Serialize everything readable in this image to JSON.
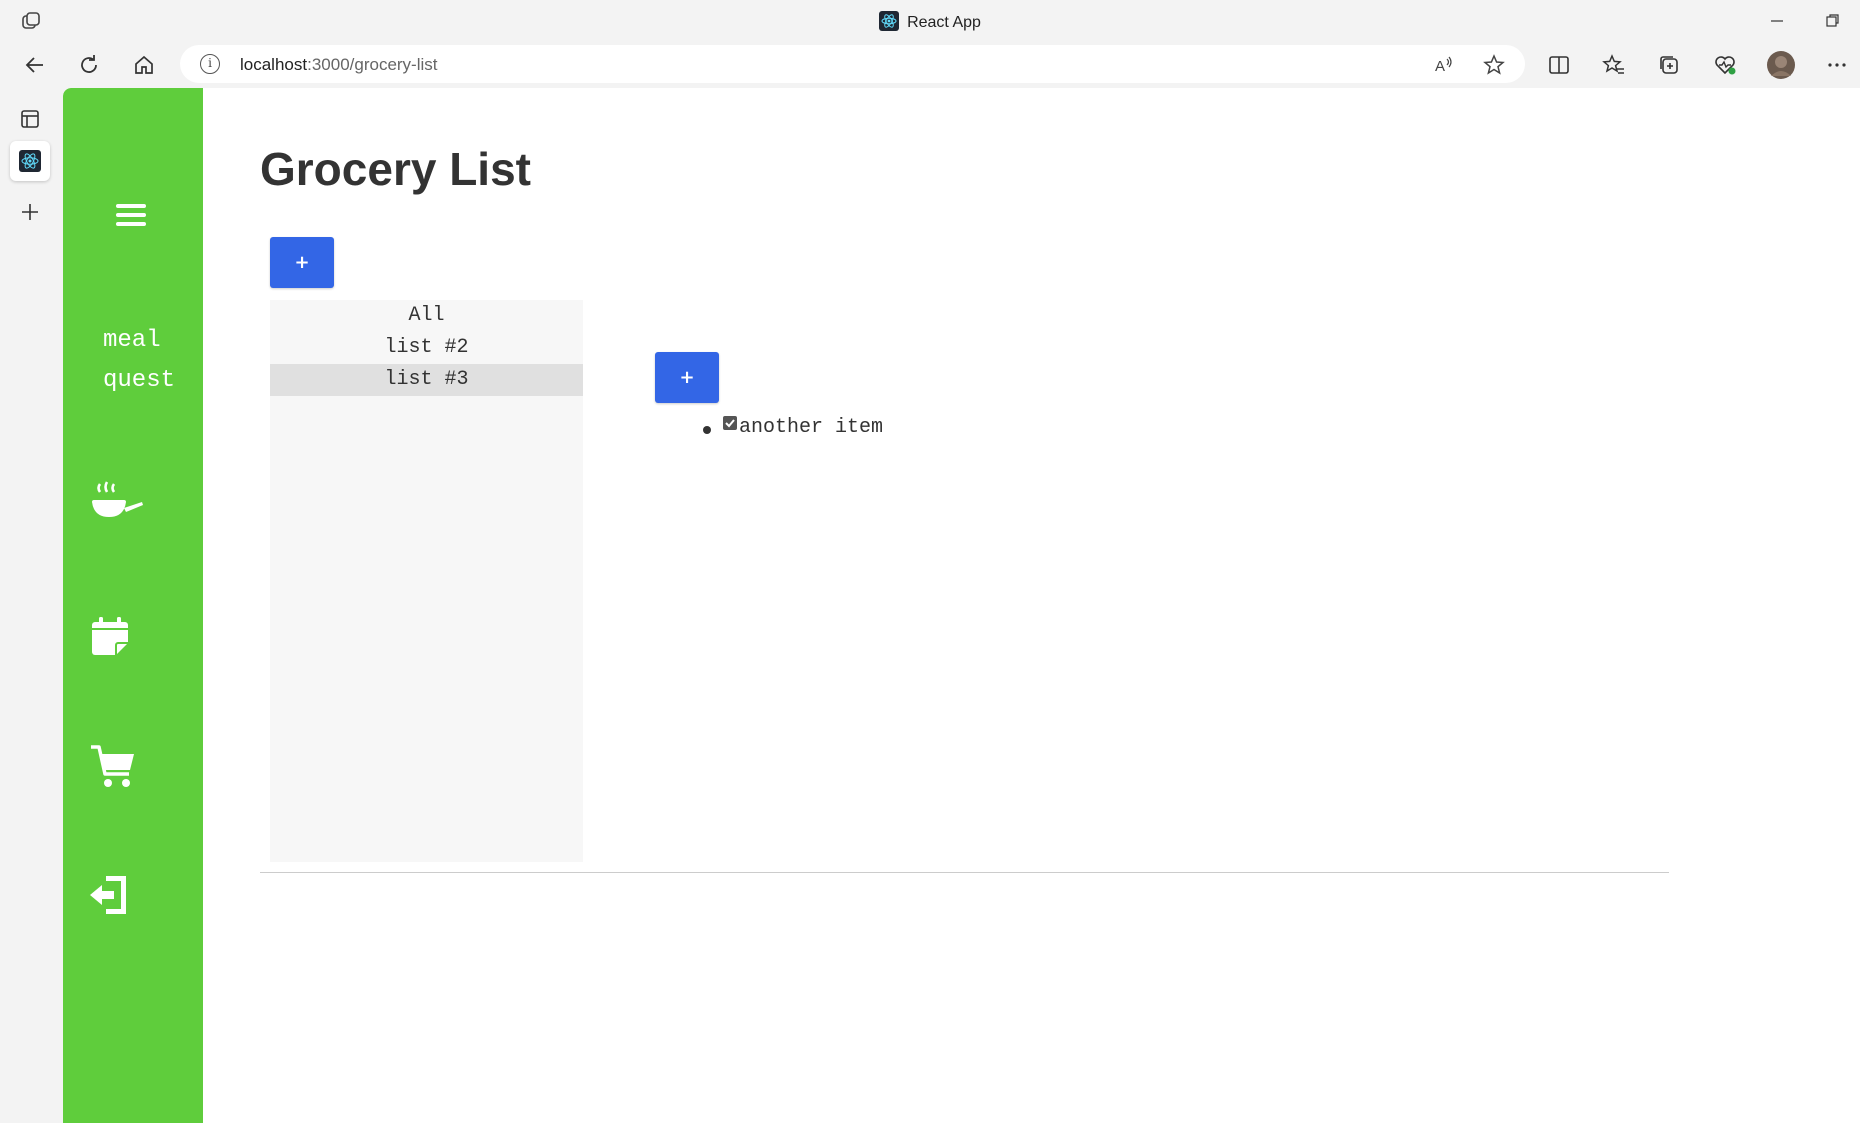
{
  "browser": {
    "window_title": "React App",
    "url_host": "localhost",
    "url_path": ":3000/grocery-list"
  },
  "sidebar": {
    "brand_line1": "meal",
    "brand_line2": "quest",
    "icons": [
      "menu-icon",
      "cooking-pan-icon",
      "calendar-icon",
      "cart-icon",
      "logout-icon"
    ]
  },
  "page": {
    "title": "Grocery List",
    "add_list_label": "+",
    "add_item_label": "+"
  },
  "lists": [
    {
      "label": "All",
      "selected": false
    },
    {
      "label": "list #2",
      "selected": false
    },
    {
      "label": "list #3",
      "selected": true
    }
  ],
  "items": [
    {
      "label": "another item",
      "checked": true
    }
  ],
  "colors": {
    "sidebar": "#5fcd3c",
    "button": "#3366e6"
  }
}
